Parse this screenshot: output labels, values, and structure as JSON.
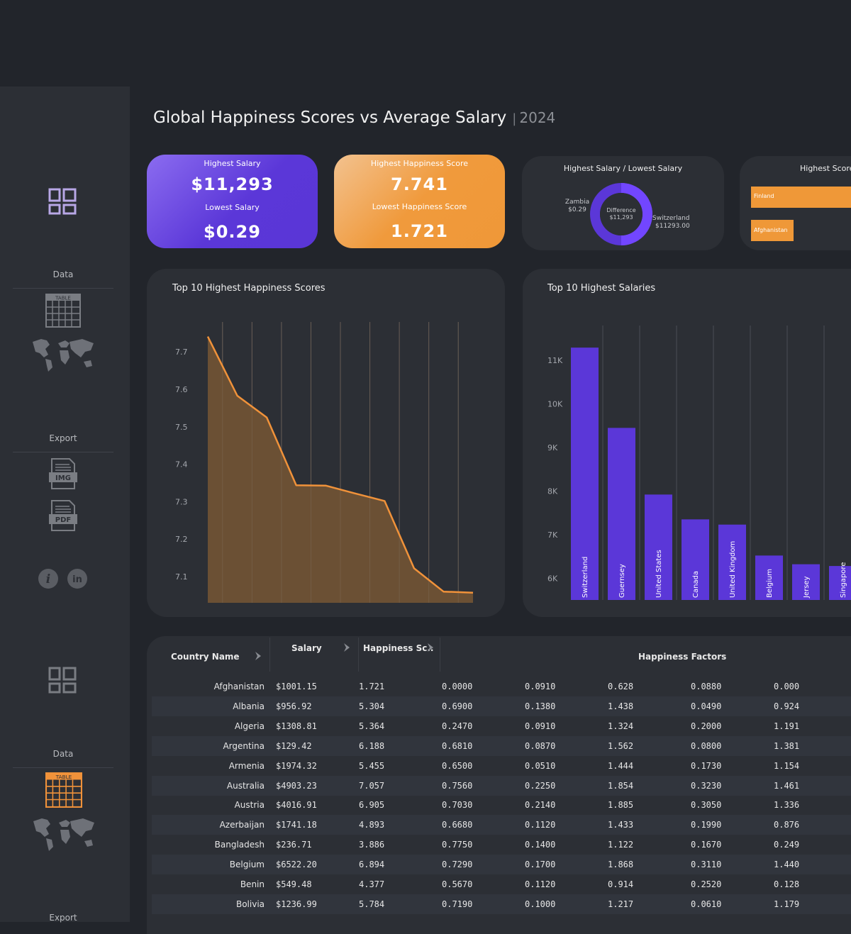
{
  "sidebar": {
    "sections": [
      {
        "data_label": "Data",
        "export_label": "Export"
      },
      {
        "data_label": "Data",
        "export_label": "Export"
      }
    ],
    "icons": {
      "dashboard": "dashboard-grid-icon",
      "table": "table-icon",
      "table_text": "TABLE",
      "map": "world-map-icon",
      "img": "IMG",
      "pdf": "PDF",
      "info": "info-icon",
      "linkedin": "linkedin-icon",
      "linkedin_text": "in"
    },
    "accent_active": "#f0923a"
  },
  "header": {
    "title": "Global Happiness Scores vs Average Salary",
    "separator": "|",
    "year": "2024"
  },
  "kpis": {
    "salary": {
      "top_label": "Highest Salary",
      "top_value": "$11,293",
      "bottom_label": "Lowest Salary",
      "bottom_value": "$0.29"
    },
    "happiness": {
      "top_label": "Highest Happiness Score",
      "top_value": "7.741",
      "bottom_label": "Lowest Happiness Score",
      "bottom_value": "1.721"
    }
  },
  "donut": {
    "title": "Highest Salary / Lowest Salary",
    "left_name": "Zambia",
    "left_value": "$0.29",
    "center_label": "Difference",
    "center_value": "$11,293",
    "right_name": "Switzerland",
    "right_value": "$11293.00"
  },
  "score_bars": {
    "title": "Highest Score ...",
    "bars": [
      {
        "label": "Finland"
      },
      {
        "label": "Afghanistan"
      }
    ]
  },
  "colors": {
    "purple": "#5b37d8",
    "orange": "#ef9838",
    "panel": "#2c2f35",
    "background": "#22252b"
  },
  "chart_data": [
    {
      "type": "area",
      "title": "Top 10 Highest Happiness Scores",
      "y_ticks": [
        "7.7",
        "7.6",
        "7.5",
        "7.4",
        "7.3",
        "7.2",
        "7.1"
      ],
      "ylim": [
        7.03,
        7.78
      ],
      "values": [
        7.741,
        7.583,
        7.525,
        7.344,
        7.343,
        7.322,
        7.302,
        7.122,
        7.06,
        7.057
      ],
      "grid": "vertical"
    },
    {
      "type": "bar",
      "title": "Top 10 Highest Salaries",
      "y_ticks": [
        "11K",
        "10K",
        "9K",
        "8K",
        "7K",
        "6K"
      ],
      "ylim": [
        5500,
        11800
      ],
      "categories": [
        "Switzerland",
        "Guernsey",
        "United States",
        "Canada",
        "United Kingdom",
        "Belgium",
        "Jersey",
        "Singapore"
      ],
      "values": [
        11293,
        9450,
        7920,
        7350,
        7230,
        6520,
        6320,
        6280
      ],
      "grid": "vertical"
    }
  ],
  "table": {
    "headers": {
      "country": "Country Name",
      "salary": "Salary",
      "happiness": "Happiness Sc..",
      "factors": "Happiness Factors"
    },
    "rows": [
      [
        "Afghanistan",
        "$1001.15",
        "1.721",
        "0.0000",
        "0.0910",
        "0.628",
        "0.0880",
        "0.000"
      ],
      [
        "Albania",
        "$956.92",
        "5.304",
        "0.6900",
        "0.1380",
        "1.438",
        "0.0490",
        "0.924"
      ],
      [
        "Algeria",
        "$1308.81",
        "5.364",
        "0.2470",
        "0.0910",
        "1.324",
        "0.2000",
        "1.191"
      ],
      [
        "Argentina",
        "$129.42",
        "6.188",
        "0.6810",
        "0.0870",
        "1.562",
        "0.0800",
        "1.381"
      ],
      [
        "Armenia",
        "$1974.32",
        "5.455",
        "0.6500",
        "0.0510",
        "1.444",
        "0.1730",
        "1.154"
      ],
      [
        "Australia",
        "$4903.23",
        "7.057",
        "0.7560",
        "0.2250",
        "1.854",
        "0.3230",
        "1.461"
      ],
      [
        "Austria",
        "$4016.91",
        "6.905",
        "0.7030",
        "0.2140",
        "1.885",
        "0.3050",
        "1.336"
      ],
      [
        "Azerbaijan",
        "$1741.18",
        "4.893",
        "0.6680",
        "0.1120",
        "1.433",
        "0.1990",
        "0.876"
      ],
      [
        "Bangladesh",
        "$236.71",
        "3.886",
        "0.7750",
        "0.1400",
        "1.122",
        "0.1670",
        "0.249"
      ],
      [
        "Belgium",
        "$6522.20",
        "6.894",
        "0.7290",
        "0.1700",
        "1.868",
        "0.3110",
        "1.440"
      ],
      [
        "Benin",
        "$549.48",
        "4.377",
        "0.5670",
        "0.1120",
        "0.914",
        "0.2520",
        "0.128"
      ],
      [
        "Bolivia",
        "$1236.99",
        "5.784",
        "0.7190",
        "0.1000",
        "1.217",
        "0.0610",
        "1.179"
      ]
    ]
  }
}
